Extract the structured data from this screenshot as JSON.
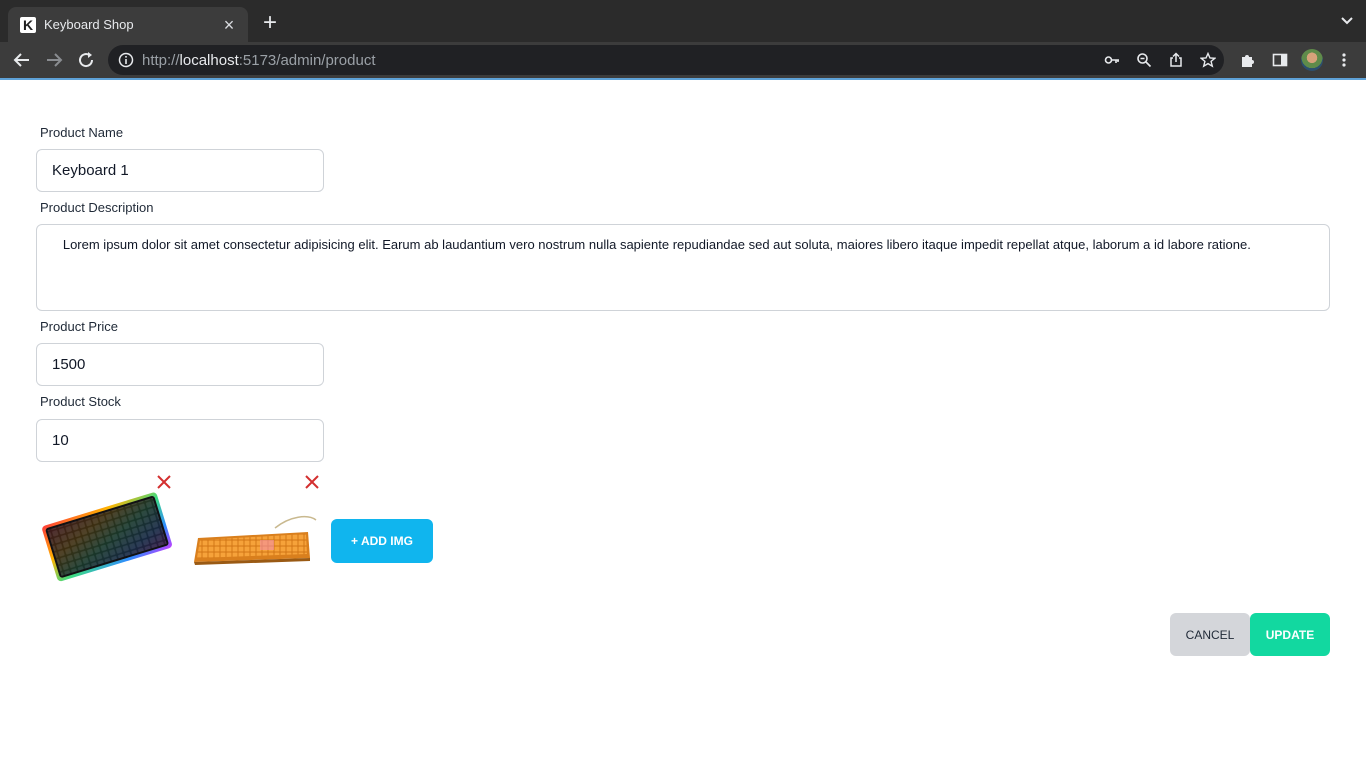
{
  "browser": {
    "tab_title": "Keyboard Shop",
    "favicon_letter": "K",
    "url_scheme": "http://",
    "url_host": "localhost",
    "url_path": ":5173/admin/product"
  },
  "form": {
    "name_label": "Product Name",
    "name_value": "Keyboard 1",
    "description_label": "Product Description",
    "description_value": "   Lorem ipsum dolor sit amet consectetur adipisicing elit. Earum ab laudantium vero nostrum nulla sapiente repudiandae sed aut soluta, maiores libero itaque impedit repellat atque, laborum a id labore ratione.",
    "price_label": "Product Price",
    "price_value": "1500",
    "stock_label": "Product Stock",
    "stock_value": "10"
  },
  "images": {
    "add_button_label": "+ ADD IMG",
    "items": [
      {
        "icon": "rgb-keyboard-image"
      },
      {
        "icon": "orange-keyboard-image"
      }
    ],
    "remove_color": "#d32f2f"
  },
  "actions": {
    "cancel_label": "CANCEL",
    "update_label": "UPDATE"
  },
  "colors": {
    "add_img": "#10b5ee",
    "update": "#12d8a0",
    "cancel": "#d4d6da"
  }
}
